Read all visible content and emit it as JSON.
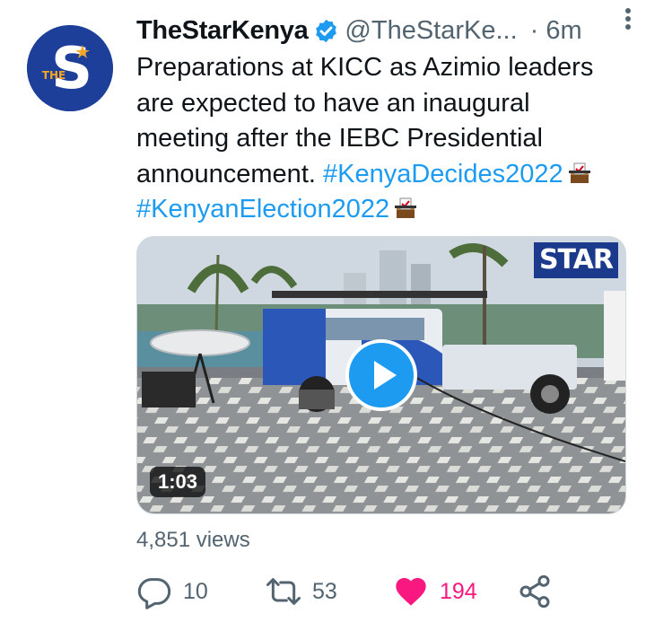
{
  "account": {
    "name": "TheStarKenya",
    "handle": "@TheStarKe...",
    "separator": "·",
    "time": "6m",
    "avatar_icon": "the-star-logo",
    "avatar_letter": "S",
    "avatar_small_text": "THE"
  },
  "tweet": {
    "text_plain": "Preparations at KICC as Azimio leaders are expected to have an inaugural meeting after the IEBC Presidential announcement. ",
    "hashtag_1": "#KenyaDecides2022",
    "hashtag_2": "#KenyanElection2022",
    "emoji_icon": "ballot-box-icon"
  },
  "media": {
    "watermark": "STAR",
    "duration": "1:03",
    "play_icon": "play-icon"
  },
  "views": "4,851 views",
  "actions": {
    "replies": "10",
    "retweets": "53",
    "likes": "194",
    "like_state": "liked"
  },
  "colors": {
    "link": "#1d9bf0",
    "secondary_text": "#536471",
    "like": "#f91880",
    "verified": "#1d9bf0",
    "avatar_bg": "#1d3f9a"
  }
}
